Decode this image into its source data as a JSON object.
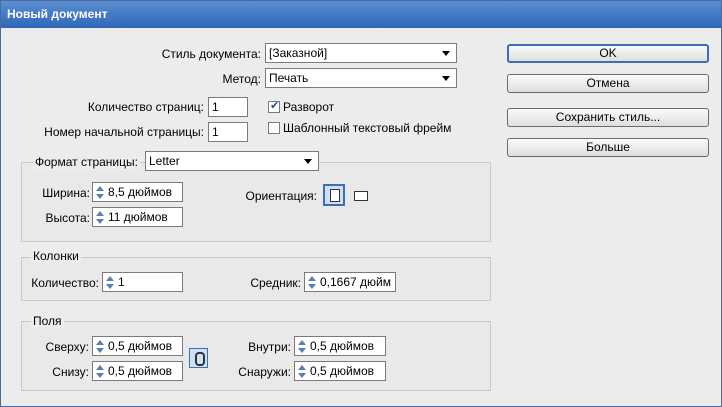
{
  "window": {
    "title": "Новый документ"
  },
  "document_style": {
    "label": "Стиль документа:",
    "value": "[Заказной]"
  },
  "method": {
    "label": "Метод:",
    "value": "Печать"
  },
  "page_count": {
    "label": "Количество страниц:",
    "value": "1"
  },
  "start_page": {
    "label": "Номер начальной страницы:",
    "value": "1"
  },
  "spread": {
    "label": "Разворот",
    "checked": true
  },
  "text_frame": {
    "label": "Шаблонный текстовый фрейм",
    "checked": false
  },
  "buttons": {
    "ok": "OK",
    "cancel": "Отмена",
    "save_style": "Сохранить стиль...",
    "more": "Больше"
  },
  "page_format": {
    "label": "Формат страницы:",
    "value": "Letter",
    "width_label": "Ширина:",
    "width_value": "8,5 дюймов",
    "height_label": "Высота:",
    "height_value": "11 дюймов",
    "orientation_label": "Ориентация:",
    "orientation": "portrait"
  },
  "columns": {
    "title": "Колонки",
    "count_label": "Количество:",
    "count_value": "1",
    "gutter_label": "Средник:",
    "gutter_value": "0,1667 дюйм"
  },
  "margins": {
    "title": "Поля",
    "top_label": "Сверху:",
    "top_value": "0,5 дюймов",
    "bottom_label": "Снизу:",
    "bottom_value": "0,5 дюймов",
    "inside_label": "Внутри:",
    "inside_value": "0,5 дюймов",
    "outside_label": "Снаружи:",
    "outside_value": "0,5 дюймов"
  }
}
